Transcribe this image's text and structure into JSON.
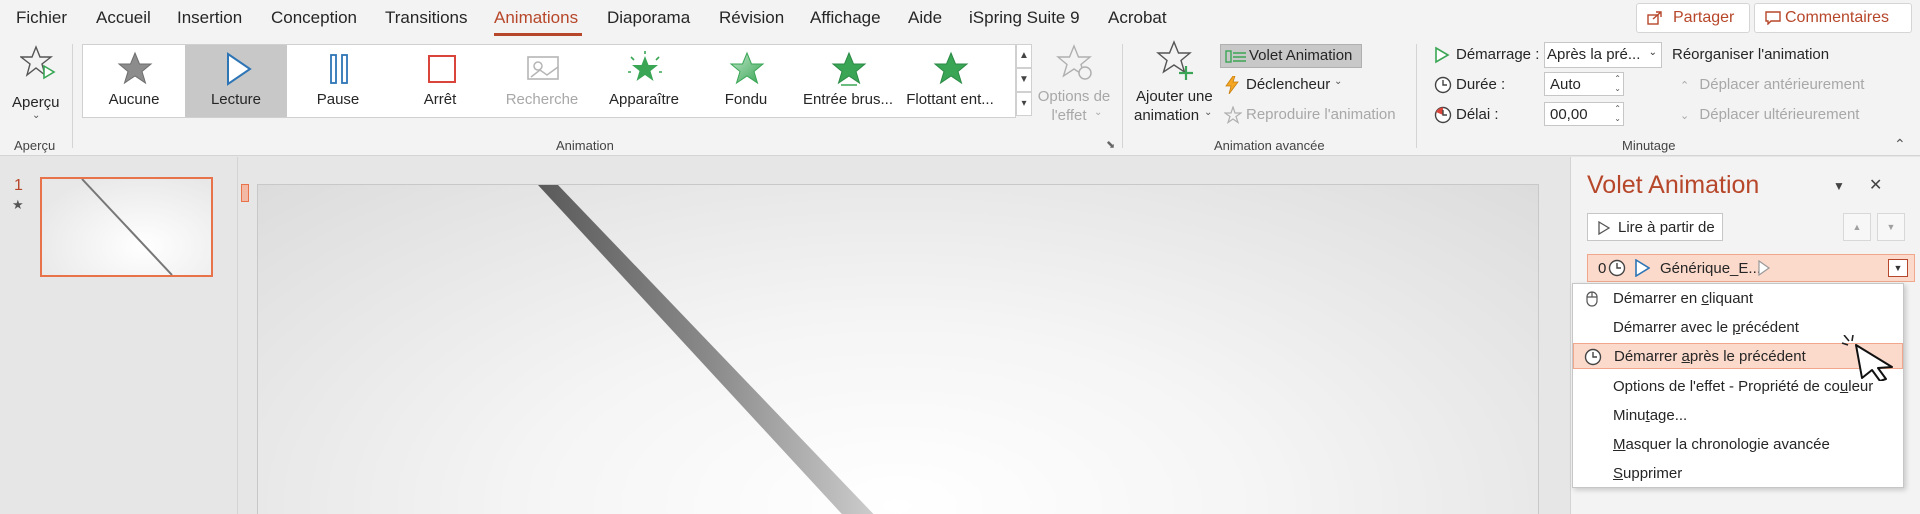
{
  "menu": {
    "tabs": [
      "Fichier",
      "Accueil",
      "Insertion",
      "Conception",
      "Transitions",
      "Animations",
      "Diaporama",
      "Révision",
      "Affichage",
      "Aide",
      "iSpring Suite 9",
      "Acrobat"
    ],
    "active_tab": "Animations",
    "share_label": "Partager",
    "comments_label": "Commentaires"
  },
  "ribbon": {
    "preview": {
      "label": "Aperçu",
      "group": "Aperçu"
    },
    "animation_group": {
      "label": "Animation",
      "gallery": [
        {
          "label": "Aucune",
          "icon": "gray-star-icon",
          "selected": false,
          "disabled": false
        },
        {
          "label": "Lecture",
          "icon": "play-icon",
          "selected": true,
          "disabled": false
        },
        {
          "label": "Pause",
          "icon": "pause-icon",
          "selected": false,
          "disabled": false
        },
        {
          "label": "Arrêt",
          "icon": "stop-icon",
          "selected": false,
          "disabled": false
        },
        {
          "label": "Recherche",
          "icon": "seek-icon",
          "selected": false,
          "disabled": true
        },
        {
          "label": "Apparaître",
          "icon": "appear-star-icon",
          "selected": false,
          "disabled": false
        },
        {
          "label": "Fondu",
          "icon": "fade-star-icon",
          "selected": false,
          "disabled": false
        },
        {
          "label": "Entrée brus...",
          "icon": "fly-in-star-icon",
          "selected": false,
          "disabled": false
        },
        {
          "label": "Flottant ent...",
          "icon": "float-in-star-icon",
          "selected": false,
          "disabled": false
        }
      ],
      "effect_options_line1": "Options de",
      "effect_options_line2": "l'effet"
    },
    "advanced_group": {
      "label": "Animation avancée",
      "add_line1": "Ajouter une",
      "add_line2": "animation",
      "pane_button": "Volet Animation",
      "trigger": "Déclencheur",
      "painter": "Reproduire l'animation"
    },
    "timing_group": {
      "label": "Minutage",
      "start_label": "Démarrage :",
      "start_value": "Après la pré...",
      "duration_label": "Durée :",
      "duration_value": "Auto",
      "delay_label": "Délai :",
      "delay_value": "00,00",
      "reorder_label": "Réorganiser l'animation",
      "move_earlier": "Déplacer antérieurement",
      "move_later": "Déplacer ultérieurement"
    }
  },
  "thumbs": {
    "slide_number": "1",
    "star": "★"
  },
  "anim_pane": {
    "title": "Volet Animation",
    "play_from": "Lire à partir de",
    "row_number": "0",
    "row_name": "Générique_E..."
  },
  "context_menu": {
    "items": [
      {
        "pre": "Démarrer en ",
        "u": "c",
        "post": "liquant",
        "icon": "mouse-icon",
        "highlight": false
      },
      {
        "pre": "Démarrer avec le ",
        "u": "p",
        "post": "récédent",
        "icon": "",
        "highlight": false
      },
      {
        "pre": "Démarrer ",
        "u": "a",
        "post": "près le précédent",
        "icon": "clock-icon",
        "highlight": true
      },
      {
        "pre": "Options de l'effet - Propriété de co",
        "u": "u",
        "post": "leur",
        "icon": "",
        "highlight": false
      },
      {
        "pre": "Minu",
        "u": "t",
        "post": "age...",
        "icon": "",
        "highlight": false
      },
      {
        "pre": "",
        "u": "M",
        "post": "asquer la chronologie avancée",
        "icon": "",
        "highlight": false
      },
      {
        "pre": "",
        "u": "S",
        "post": "upprimer",
        "icon": "",
        "highlight": false
      }
    ]
  },
  "colors": {
    "accent": "#b7472a",
    "highlight": "#fbd9cb",
    "green": "#3aa655",
    "blue": "#2e75b6",
    "red": "#d9453a"
  }
}
